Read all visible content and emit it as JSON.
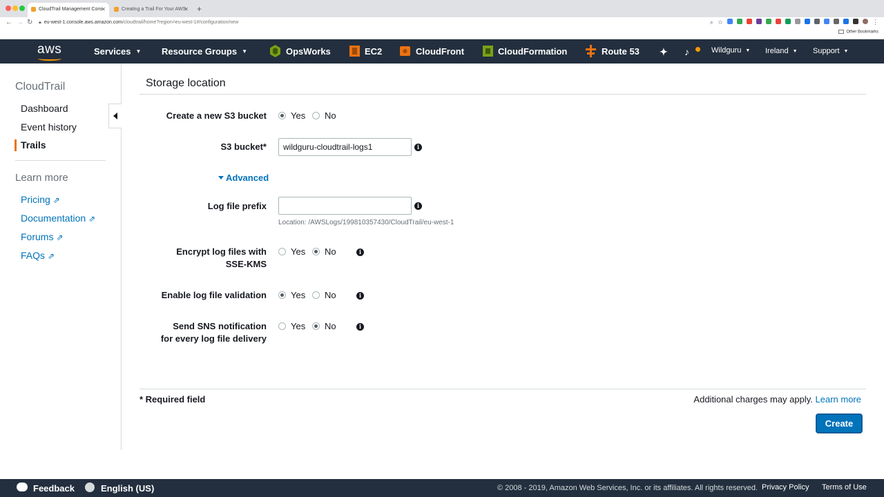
{
  "browser": {
    "tabs": [
      {
        "title": "CloudTrail Management Cons"
      },
      {
        "title": "Creating a Trail For Your AWS"
      }
    ],
    "url_host": "eu-west-1.console.aws.amazon.com",
    "url_path": "/cloudtrail/home?region=eu-west-1#/configuration/new",
    "bookmarks_label": "Other Bookmarks"
  },
  "awsnav": {
    "logo": "aws",
    "services": "Services",
    "resource_groups": "Resource Groups",
    "shortcuts": [
      {
        "label": "OpsWorks",
        "color": "#7aa116"
      },
      {
        "label": "EC2",
        "color": "#ec7211"
      },
      {
        "label": "CloudFront",
        "color": "#ec7211"
      },
      {
        "label": "CloudFormation",
        "color": "#7aa116"
      },
      {
        "label": "Route 53",
        "color": "#ec7211"
      }
    ],
    "pin_icon": "pin-icon",
    "bell_icon": "bell-icon",
    "account": "Wildguru",
    "region": "Ireland",
    "support": "Support"
  },
  "sidebar": {
    "title": "CloudTrail",
    "items": [
      {
        "label": "Dashboard"
      },
      {
        "label": "Event history"
      },
      {
        "label": "Trails"
      }
    ],
    "learn_more": "Learn more",
    "links": [
      {
        "label": "Pricing"
      },
      {
        "label": "Documentation"
      },
      {
        "label": "Forums"
      },
      {
        "label": "FAQs"
      }
    ]
  },
  "form": {
    "section_title": "Storage location",
    "create_bucket": {
      "label": "Create a new S3 bucket",
      "yes": "Yes",
      "no": "No",
      "selected": "Yes"
    },
    "s3_bucket": {
      "label": "S3 bucket*",
      "value": "wildguru-cloudtrail-logs1"
    },
    "advanced": "Advanced",
    "log_prefix": {
      "label": "Log file prefix",
      "value": "",
      "hint": "Location: /AWSLogs/199810357430/CloudTrail/eu-west-1"
    },
    "encrypt": {
      "label": "Encrypt log files with SSE-KMS",
      "yes": "Yes",
      "no": "No",
      "selected": "No"
    },
    "validation": {
      "label": "Enable log file validation",
      "yes": "Yes",
      "no": "No",
      "selected": "Yes"
    },
    "sns": {
      "label": "Send SNS notification for every log file delivery",
      "yes": "Yes",
      "no": "No",
      "selected": "No"
    },
    "required": "* Required field",
    "charges": "Additional charges may apply.",
    "learn_more": "Learn more",
    "create": "Create"
  },
  "footer": {
    "feedback": "Feedback",
    "language": "English (US)",
    "copyright": "© 2008 - 2019, Amazon Web Services, Inc. or its affiliates. All rights reserved.",
    "privacy": "Privacy Policy",
    "terms": "Terms of Use"
  }
}
